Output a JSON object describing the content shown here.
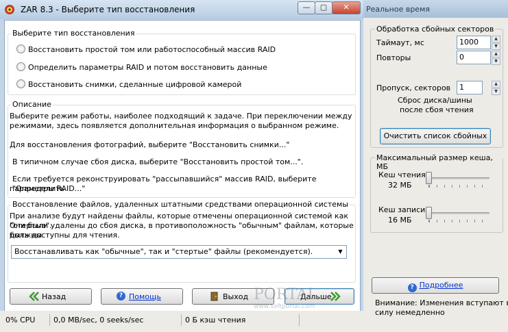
{
  "side_panel": {
    "title": "Реальное время",
    "bad_sectors": {
      "legend": "Обработка сбойных секторов",
      "timeout_label": "Таймаут, мс",
      "timeout_value": "1000",
      "retries_label": "Повторы",
      "retries_value": "0",
      "skip_label": "Пропуск, секторов",
      "skip_value": "1",
      "reset_note_1": "Сброс диска/шины",
      "reset_note_2": "после сбоя чтения",
      "clear_button": "Очистить список сбойных"
    },
    "cache": {
      "legend": "Максимальный размер кеша, МБ",
      "read_label": "Кеш чтения",
      "read_value": "32 МБ",
      "write_label": "Кеш записи",
      "write_value": "16 МБ"
    },
    "more_link": "Подробнее",
    "notice_1": "Внимание: Изменения вступают в",
    "notice_2": "силу немедленно"
  },
  "main": {
    "title": "ZAR 8.3 - Выберите тип восстановления",
    "window_controls": {
      "minimize": "—",
      "maximize": "▢",
      "close": "✕"
    },
    "recovery_type": {
      "legend": "Выберите тип восстановления",
      "options": [
        "Восстановить простой том или работоспособный массив RAID",
        "Определить параметры RAID и потом восстановить данные",
        "Восстановить снимки, сделанные цифровой камерой"
      ]
    },
    "description": {
      "legend": "Описание",
      "line1": "Выберите режим работы, наиболее подходящий к задаче. При переключении между",
      "line2": "режимами, здесь появляется дополнительная информация о выбранном режиме.",
      "line3": "Для восстановления фотографий, выберите \"Восстановить снимки...\"",
      "line4": "В типичном случае сбоя диска, выберите \"Восстановить простой том...\".",
      "line5": "Если требуется реконструировать \"рассыпавшийся\" массив RAID, выберите \"Определить",
      "line6": "параметры RAID...\""
    },
    "deleted_files": {
      "legend": "Восстановление файлов, удаленных штатными средствами операционной системы",
      "line1": "При анализе будут найдены файлы, которые отмечены операционной системой как \"стертые\".",
      "line2": "Они были удалены до сбоя диска, в противоположность \"обычным\" файлам, которые должны",
      "line3": "быть доступны для чтения.",
      "select_value": "Восстанавливать как \"обычные\", так и \"стертые\" файлы (рекомендуется)."
    },
    "buttons": {
      "back": "Назад",
      "help": "Помощь",
      "exit": "Выход",
      "next": "Дальше"
    },
    "status": {
      "cpu": "0% CPU",
      "io": "0,0 MB/sec, 0 seeks/sec",
      "cache": "0 Б кэш чтения"
    },
    "watermark_1": "PORTAL",
    "watermark_2": "www.softportal.com"
  }
}
